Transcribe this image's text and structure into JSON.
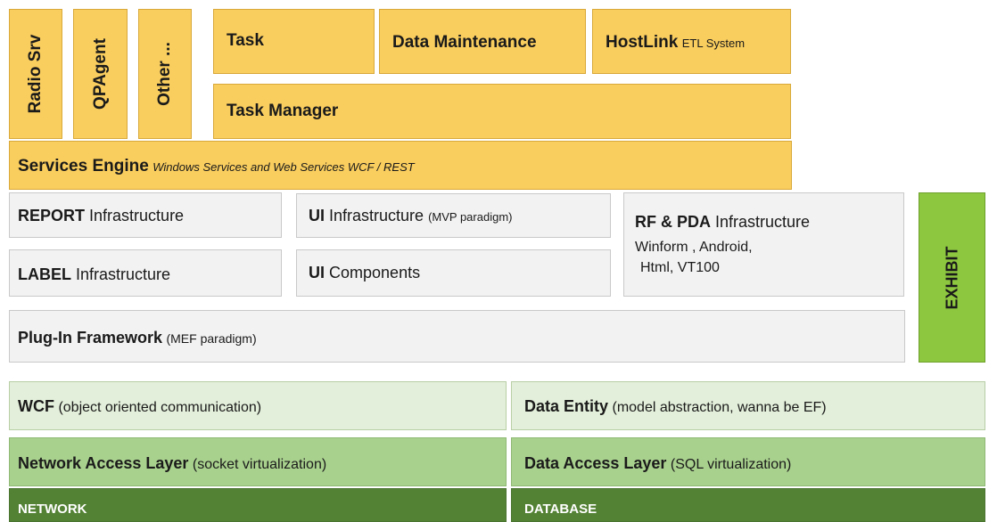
{
  "vertical_services": [
    "Radio Srv",
    "QPAgent",
    "Other ..."
  ],
  "task": "Task",
  "data_maintenance": "Data Maintenance",
  "hostlink": {
    "title": "HostLink",
    "subtitle": "ETL System"
  },
  "task_manager": "Task Manager",
  "services_engine": {
    "title": "Services Engine",
    "subtitle": "Windows Services and Web Services WCF / REST"
  },
  "report": {
    "title": "REPORT",
    "rest": "Infrastructure"
  },
  "label": {
    "title": "LABEL",
    "rest": "Infrastructure"
  },
  "ui_infra": {
    "title": "UI",
    "rest": "Infrastructure",
    "note": "(MVP paradigm)"
  },
  "ui_components": {
    "title": "UI",
    "rest": "Components"
  },
  "rf_pda": {
    "title": "RF & PDA",
    "rest": "Infrastructure",
    "line2": "Winform , Android,",
    "line3": "Html, VT100"
  },
  "plugin": {
    "title": "Plug-In Framework",
    "note": "(MEF paradigm)"
  },
  "exhibit": "EXHIBIT",
  "wcf": {
    "title": "WCF",
    "note": "(object oriented communication)"
  },
  "data_entity": {
    "title": "Data Entity",
    "note": "(model abstraction, wanna be EF)"
  },
  "network_access": {
    "title": "Network Access Layer",
    "note": "(socket virtualization)"
  },
  "data_access": {
    "title": "Data Access Layer",
    "note": "(SQL virtualization)"
  },
  "network": "NETWORK",
  "database": "DATABASE",
  "colors": {
    "yellow": "#f9cd5e",
    "gray": "#f2f2f2",
    "light_green": "#e3efda",
    "medium_green": "#a9d18e",
    "dark_green": "#548235",
    "exhibit_green": "#8dc63f"
  }
}
